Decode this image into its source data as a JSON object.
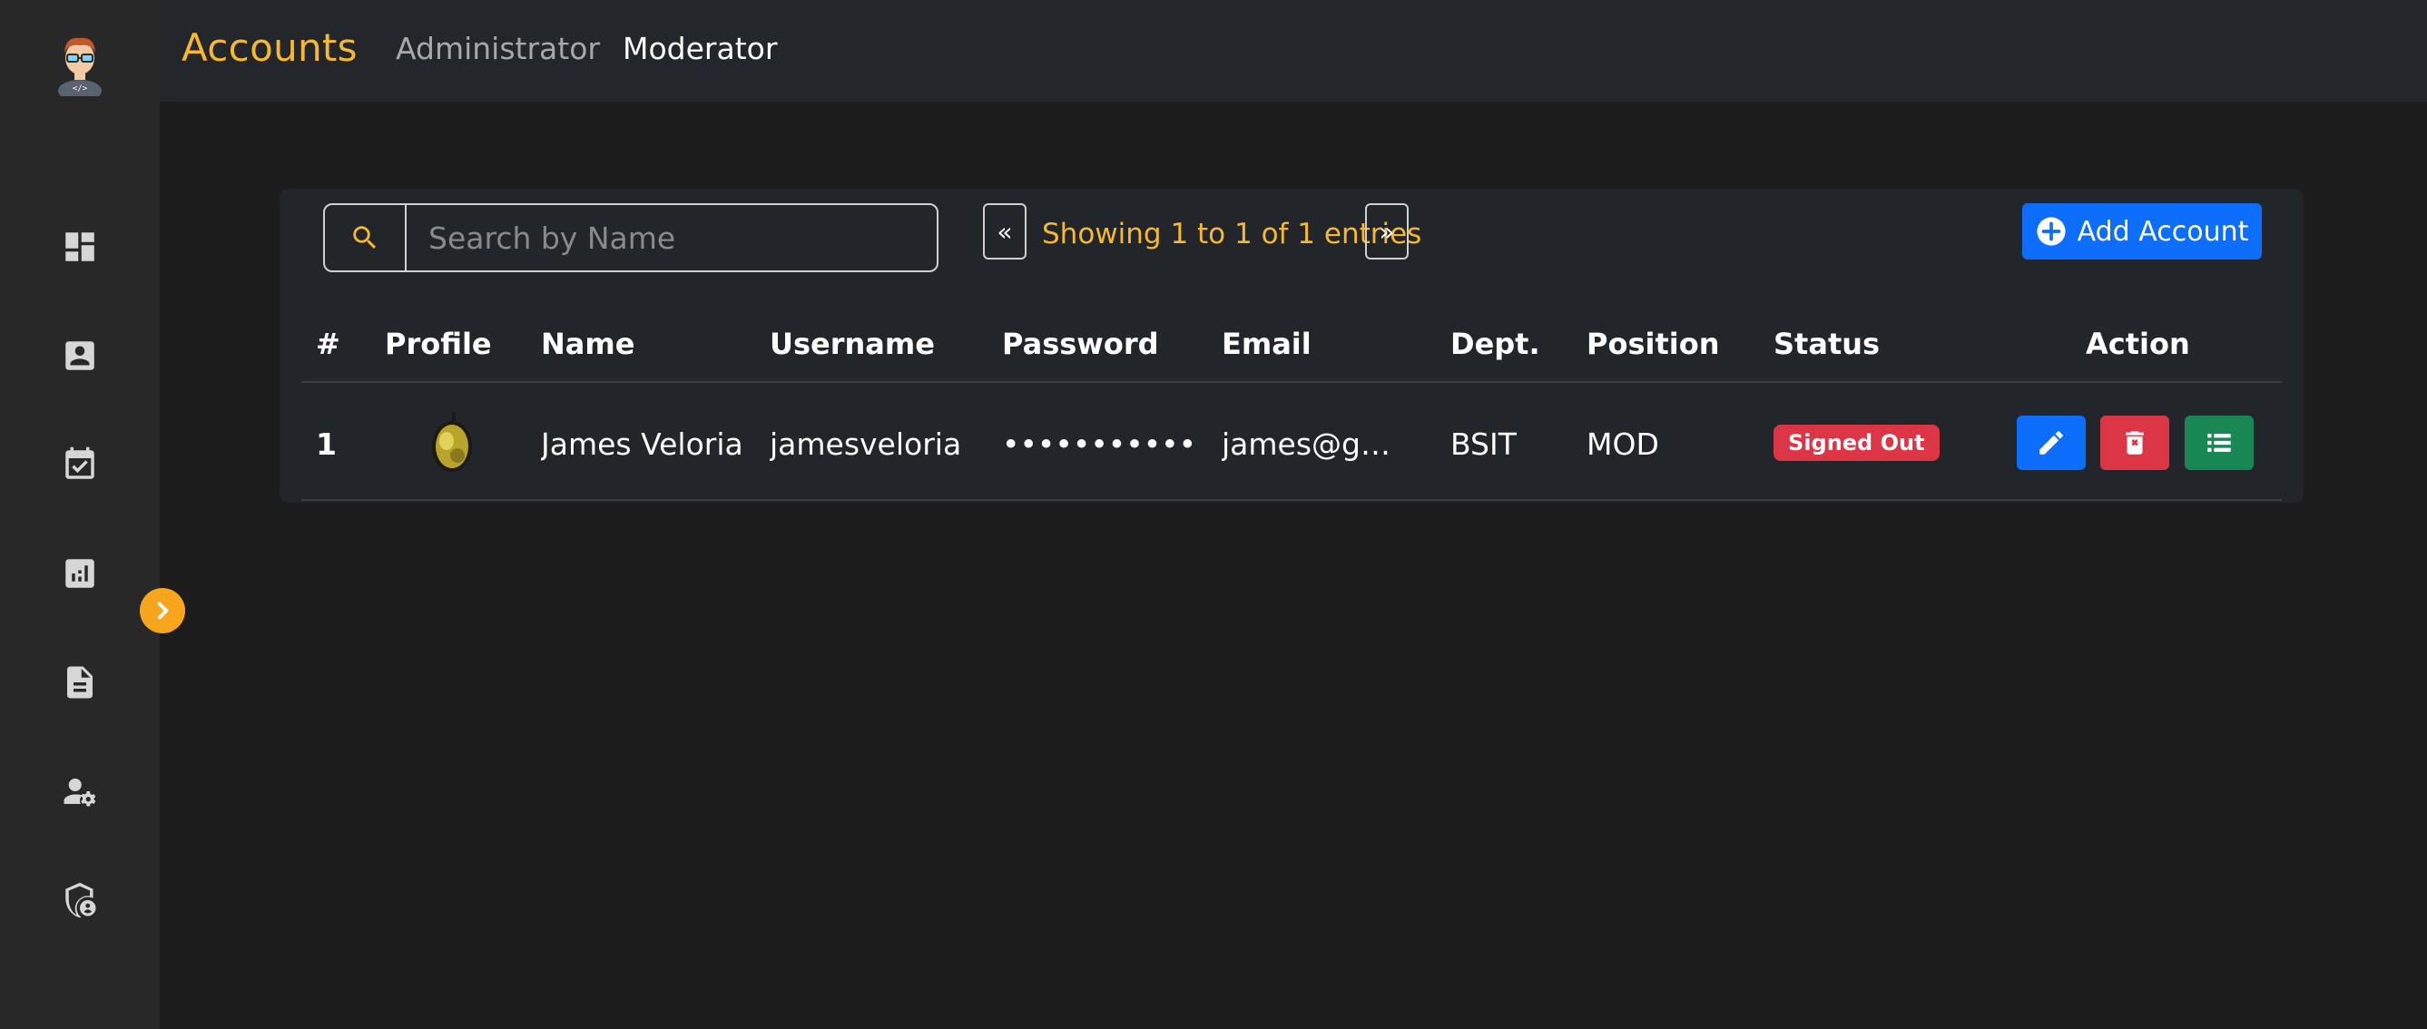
{
  "header": {
    "title": "Accounts",
    "tabs": [
      {
        "label": "Administrator",
        "active": false
      },
      {
        "label": "Moderator",
        "active": true
      }
    ]
  },
  "sidebar": {
    "items": [
      {
        "icon": "dashboard-icon"
      },
      {
        "icon": "contact-card-icon"
      },
      {
        "icon": "calendar-check-icon"
      },
      {
        "icon": "analytics-icon"
      },
      {
        "icon": "document-icon"
      },
      {
        "icon": "user-settings-icon"
      },
      {
        "icon": "shield-user-icon"
      }
    ],
    "collapse_icon": "chevron-right-icon"
  },
  "toolbar": {
    "search_placeholder": "Search by Name",
    "prev_label": "«",
    "next_label": "»",
    "entries_info": "Showing 1 to 1 of 1 entries",
    "add_label": "Add Account"
  },
  "table": {
    "headers": [
      "#",
      "Profile",
      "Name",
      "Username",
      "Password",
      "Email",
      "Dept.",
      "Position",
      "Status",
      "Action"
    ],
    "rows": [
      {
        "num": "1",
        "name": "James Veloria",
        "username": "jamesveloria",
        "password": "•••••••••••",
        "email": "james@gmail.com",
        "dept": "BSIT",
        "position": "MOD",
        "status": "Signed Out"
      }
    ]
  },
  "colors": {
    "accent": "#f5b82e",
    "primary": "#0d6efd",
    "danger": "#dc3545",
    "success": "#198754",
    "background": "#1c1c1c",
    "sidebar": "#282828",
    "card": "#22252a"
  }
}
